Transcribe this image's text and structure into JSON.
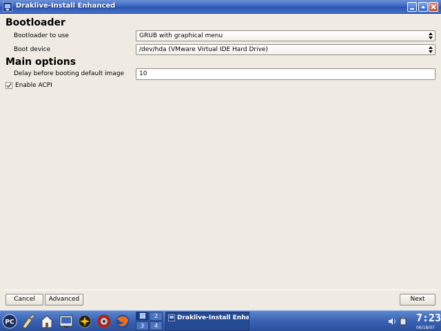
{
  "window": {
    "title": "Draklive-Install Enhanced"
  },
  "bootloader_section": {
    "heading": "Bootloader",
    "bootloader_label": "Bootloader to use",
    "bootloader_value": "GRUB with graphical menu",
    "device_label": "Boot device",
    "device_value": "/dev/hda (VMware Virtual IDE Hard Drive)"
  },
  "main_section": {
    "heading": "Main options",
    "delay_label": "Delay before booting default image",
    "delay_value": "10",
    "acpi_label": "Enable ACPI",
    "acpi_checked": true
  },
  "buttons": {
    "cancel": "Cancel",
    "advanced": "Advanced",
    "next": "Next"
  },
  "taskbar": {
    "start_label": "PC",
    "pager": [
      "1",
      "2",
      "3",
      "4"
    ],
    "task_label": "Draklive-Install Enha",
    "clock": "7:23",
    "date": "06/18/07"
  }
}
